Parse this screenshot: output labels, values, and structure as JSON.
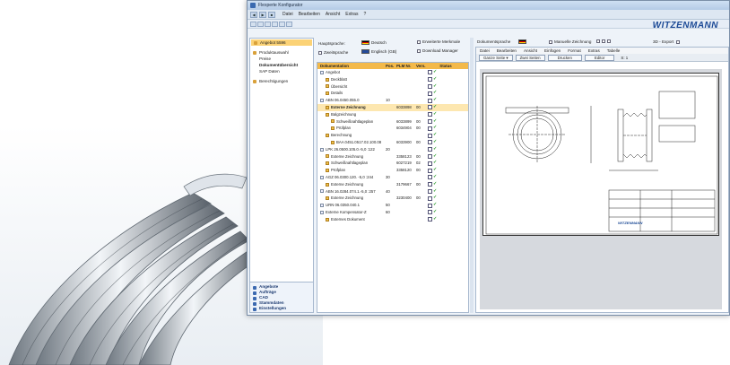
{
  "window": {
    "title": "Flexperte Konfigurator"
  },
  "menu": [
    "Datei",
    "Bearbeiten",
    "Ansicht",
    "Extras",
    "?"
  ],
  "brand": "WITZENMANN",
  "sidebar": {
    "items": [
      {
        "label": "Angebot 5596",
        "selected": true
      },
      {
        "label": "Produktauswahl"
      },
      {
        "label": "Preise"
      },
      {
        "label": "Dokumentübersicht",
        "bold": true
      },
      {
        "label": "SAP Daten"
      },
      {
        "label": "Berechtigungen"
      }
    ],
    "bottom": [
      "Angebote",
      "Aufträge",
      "CAD",
      "Stammdaten",
      "Einstellungen"
    ]
  },
  "options": {
    "hauptsprache_label": "Hauptsprache:",
    "hauptsprache_value": "Deutsch",
    "zweitsprache_label": "Zweitsprache",
    "zweitsprache_value": "Englisch (GB)",
    "erweiterte": "Erweiterte Merkmale",
    "download": "Download Manager"
  },
  "tree": {
    "headers": [
      "Dokumentation",
      "Pos.",
      "PLM Nr.",
      "Vers.",
      "Status"
    ],
    "rows": [
      {
        "label": "Angebot",
        "indent": 0,
        "pos": "",
        "plm": "",
        "vers": ""
      },
      {
        "label": "Deckblatt",
        "indent": 1,
        "pos": "",
        "plm": "",
        "vers": ""
      },
      {
        "label": "Übersicht",
        "indent": 1,
        "pos": "",
        "plm": "",
        "vers": ""
      },
      {
        "label": "Details",
        "indent": 1,
        "pos": "",
        "plm": "",
        "vers": ""
      },
      {
        "label": "ABN 06.0450.055.0",
        "indent": 0,
        "pos": "10",
        "plm": "",
        "vers": ""
      },
      {
        "label": "Externe Zeichnung",
        "indent": 1,
        "pos": "",
        "plm": "6033898",
        "vers": "00",
        "bold": true,
        "hl": true
      },
      {
        "label": "Balgzeichnung",
        "indent": 1,
        "pos": "",
        "plm": "",
        "vers": ""
      },
      {
        "label": "Schweißnahtlageplan",
        "indent": 2,
        "pos": "",
        "plm": "6033899",
        "vers": "00"
      },
      {
        "label": "Prüfplan",
        "indent": 2,
        "pos": "",
        "plm": "6034904",
        "vers": "00"
      },
      {
        "label": "Berechnung",
        "indent": 1,
        "pos": "",
        "plm": "",
        "vers": ""
      },
      {
        "label": "BAA 0451.0517.02.100.08",
        "indent": 2,
        "pos": "",
        "plm": "6033900",
        "vers": "00"
      },
      {
        "label": "LPK 26.0500.105.0.-5,0 :122",
        "indent": 0,
        "pos": "20",
        "plm": "",
        "vers": ""
      },
      {
        "label": "Externe Zeichnung",
        "indent": 1,
        "pos": "",
        "plm": "3358123",
        "vers": "00"
      },
      {
        "label": "Schweißnahtlageplan",
        "indent": 1,
        "pos": "",
        "plm": "6027219",
        "vers": "02"
      },
      {
        "label": "Prüfplan",
        "indent": 1,
        "pos": "",
        "plm": "3358120",
        "vers": "00"
      },
      {
        "label": "AGZ 06.0300.120. -5,0 :244",
        "indent": 0,
        "pos": "30",
        "plm": "",
        "vers": ""
      },
      {
        "label": "Externe Zeichnung",
        "indent": 1,
        "pos": "",
        "plm": "3179667",
        "vers": "00"
      },
      {
        "label": "ABN 16.0284.074.1.-5,0 :257",
        "indent": 0,
        "pos": "40",
        "plm": "",
        "vers": ""
      },
      {
        "label": "Externe Zeichnung",
        "indent": 1,
        "pos": "",
        "plm": "3230400",
        "vers": "00"
      },
      {
        "label": "URN 06.0350.040.1",
        "indent": 0,
        "pos": "50",
        "plm": "",
        "vers": ""
      },
      {
        "label": "Externe Kompensator-Z",
        "indent": 0,
        "pos": "60",
        "plm": "",
        "vers": ""
      },
      {
        "label": "Externes Dokument",
        "indent": 1,
        "pos": "",
        "plm": "",
        "vers": ""
      }
    ]
  },
  "right": {
    "dok_sprache_label": "Dokumentsprache",
    "manuelle": "Manuelle Zeichnung",
    "export": "3D - Export",
    "viewer_menu": [
      "Datei",
      "Bearbeiten",
      "Ansicht",
      "Einfügen",
      "Format",
      "Extras",
      "Tabelle"
    ],
    "zoom_select": "Ganze Seite",
    "btn_two": "Zwei Seiten",
    "btn_print": "Drucken",
    "btn_edit": "Editor",
    "page_label": "S: 1",
    "sheet_logo": "WITZENMANN"
  }
}
